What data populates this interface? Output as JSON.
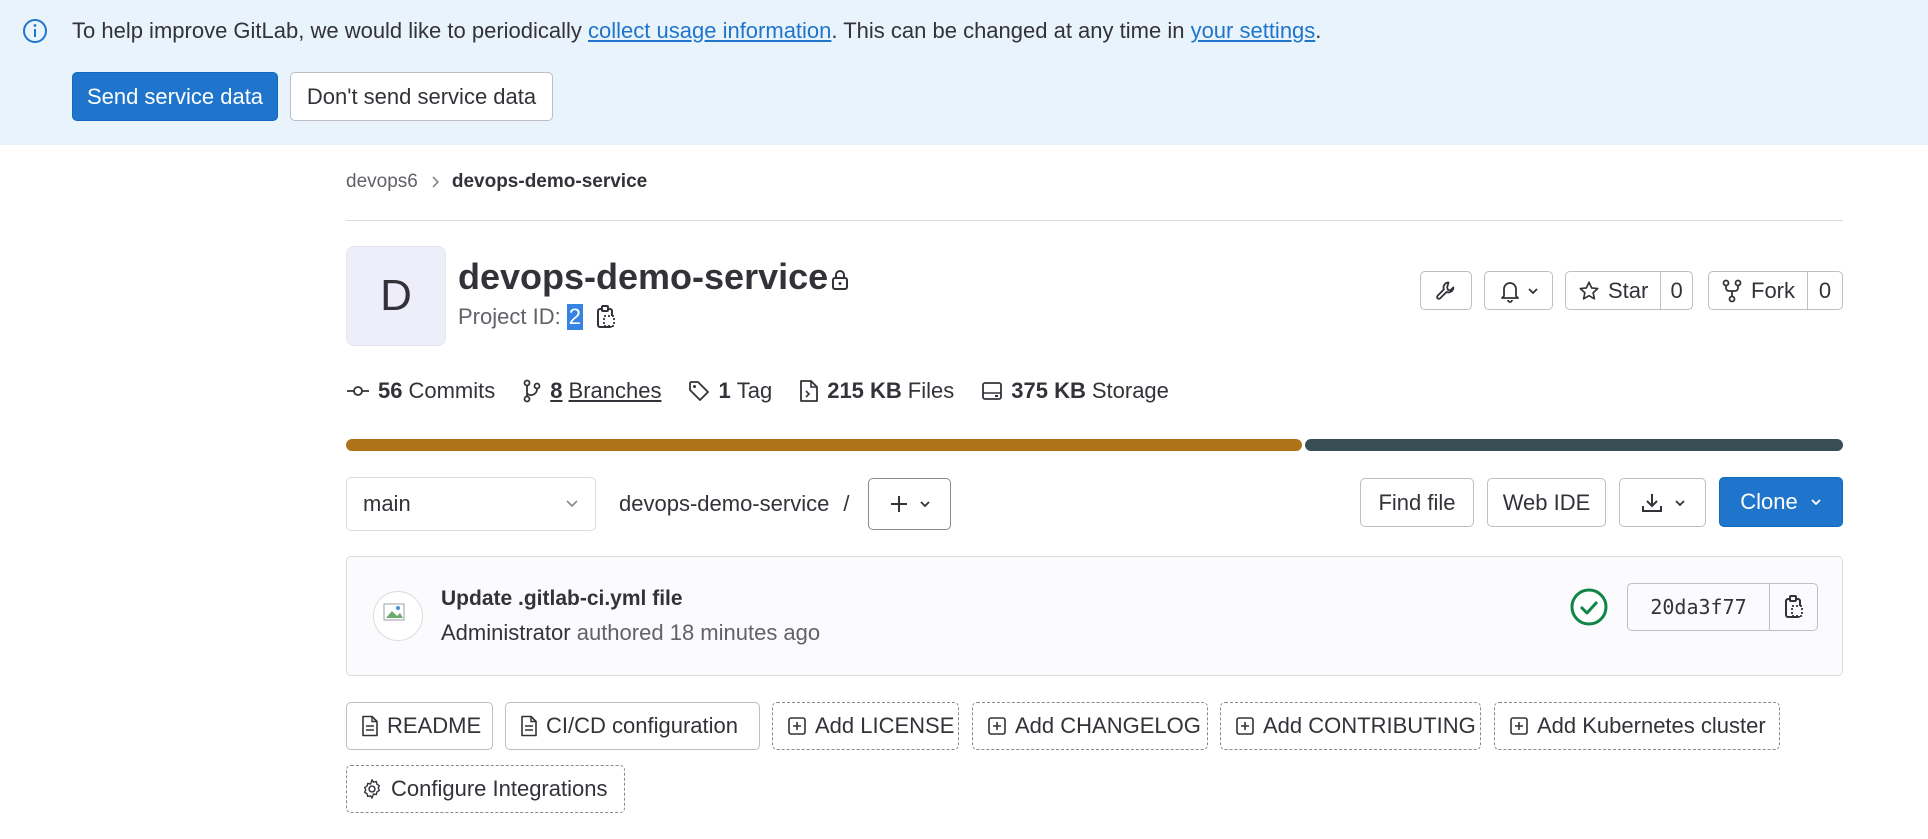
{
  "banner": {
    "text_before": "To help improve GitLab, we would like to periodically ",
    "link_usage": "collect usage information",
    "text_middle": ". This can be changed at any time in ",
    "link_settings": "your settings",
    "text_after": ".",
    "send_label": "Send service data",
    "dont_send_label": "Don't send service data",
    "icon": "info-icon"
  },
  "breadcrumb": {
    "parent": "devops6",
    "current": "devops-demo-service"
  },
  "project": {
    "avatar_letter": "D",
    "name": "devops-demo-service",
    "id_label": "Project ID:",
    "id_value": "2",
    "star_label": "Star",
    "star_count": "0",
    "fork_label": "Fork",
    "fork_count": "0"
  },
  "stats": {
    "commits_count": "56",
    "commits_label": "Commits",
    "branches_count": "8",
    "branches_label": "Branches",
    "tags_count": "1",
    "tags_label": "Tag",
    "files_size": "215 KB",
    "files_label": "Files",
    "storage_size": "375 KB",
    "storage_label": "Storage"
  },
  "languages": [
    {
      "fraction": 0.64,
      "color": "#b07219"
    },
    {
      "fraction": 0.36,
      "color": "#384d54"
    }
  ],
  "toolbar": {
    "branch": "main",
    "path": "devops-demo-service",
    "path_sep": "/",
    "find_file": "Find file",
    "web_ide": "Web IDE",
    "clone": "Clone"
  },
  "commit": {
    "title": "Update .gitlab-ci.yml file",
    "author": "Administrator",
    "authored_text": "authored",
    "time": "18 minutes ago",
    "sha": "20da3f77",
    "status": "passed",
    "status_color": "#108548"
  },
  "quick_actions": [
    {
      "label": "README",
      "style": "solid",
      "icon": "document-icon"
    },
    {
      "label": "CI/CD configuration",
      "style": "solid",
      "icon": "document-icon"
    },
    {
      "label": "Add LICENSE",
      "style": "dashed",
      "icon": "plus-square-icon"
    },
    {
      "label": "Add CHANGELOG",
      "style": "dashed",
      "icon": "plus-square-icon"
    },
    {
      "label": "Add CONTRIBUTING",
      "style": "dashed",
      "icon": "plus-square-icon"
    },
    {
      "label": "Add Kubernetes cluster",
      "style": "dashed",
      "icon": "plus-square-icon"
    },
    {
      "label": "Configure Integrations",
      "style": "dashed",
      "icon": "gear-icon"
    }
  ]
}
